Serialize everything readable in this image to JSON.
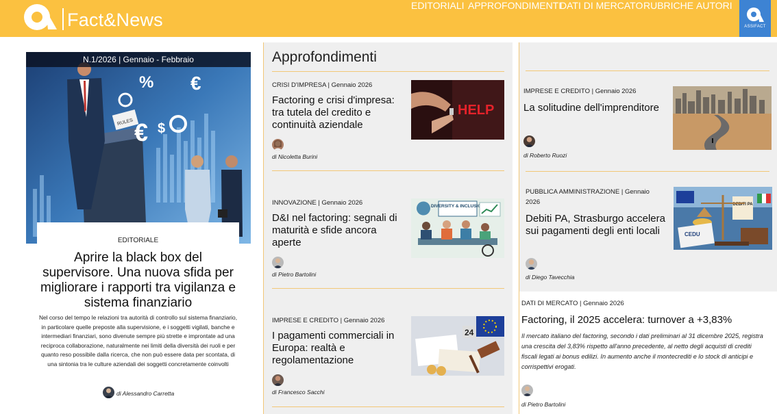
{
  "header": {
    "logo_text": "Fact&News",
    "nav": [
      "EDITORIALI",
      "APPROFONDIMENTI",
      "DATI DI MERCATO",
      "RUBRICHE",
      "AUTORI"
    ],
    "assifact_label": "ASSIFACT"
  },
  "editorial": {
    "issue": "N.1/2026 | Gennaio - Febbraio",
    "category": "EDITORIALE",
    "title": "Aprire la black box del supervisore. Una nuova sfida per migliorare i rapporti tra vigilanza e sistema finanziario",
    "excerpt": "Nel corso del tempo le relazioni tra autorità di controllo sul sistema finanziario, in particolare quelle preposte alla supervisione, e i soggetti vigilati, banche e intermediari finanziari, sono divenute sempre più strette e improntate ad una reciproca collaborazione, naturalmente nei limiti della diversità dei ruoli e per quanto reso possibile dalla ricerca, che non può essere data per scontata, di una sintonia tra le culture aziendali dei soggetti concretamente coinvolti",
    "author": "di Alessandro Carretta",
    "image_words": {
      "rules": "RULES"
    }
  },
  "approfondimenti": {
    "section_title": "Approfondimenti",
    "articles": [
      {
        "category": "CRISI D'IMPRESA | Gennaio 2026",
        "title": "Factoring e crisi d'impresa: tra tutela del credito e continuità aziendale",
        "author": "di Nicoletta Burini",
        "image_text": "HELP"
      },
      {
        "category": "INNOVAZIONE | Gennaio 2026",
        "title": "D&I nel factoring: segnali di maturità e sfide ancora aperte",
        "author": "di Pietro Bartolini",
        "image_text": "DIVERSITY & INCLUSION"
      },
      {
        "category": "IMPRESE E CREDITO | Gennaio 2026",
        "title": "I pagamenti commerciali in Europa: realtà e regolamentazione",
        "author": "di Francesco Sacchi",
        "image_text": "24"
      }
    ]
  },
  "right": {
    "articles": [
      {
        "category": "IMPRESE E CREDITO | Gennaio 2026",
        "title": "La solitudine dell'imprenditore",
        "author": "di Roberto Ruozi"
      },
      {
        "category_line1": "PUBBLICA AMMINISTRAZIONE | Gennaio",
        "category_line2": "2026",
        "title": "Debiti PA, Strasburgo accelera sui pagamenti degli enti locali",
        "author": "di Diego Tavecchia",
        "image_text_1": "DEBITI PA",
        "image_text_2": "CEDU"
      }
    ],
    "news": {
      "category": "DATI DI MERCATO | Gennaio 2026",
      "title": "Factoring, il 2025 accelera: turnover a +3,83%",
      "excerpt": "Il mercato italiano del factoring, secondo i dati preliminari al 31 dicembre 2025, registra una crescita del 3,83% rispetto all'anno precedente, al netto degli acquisti di crediti fiscali legati ai bonus edilizi. In aumento anche il montecrediti e lo stock di anticipi e corrispettivi erogati.",
      "author": "di Pietro Bartolini"
    }
  },
  "colors": {
    "header_bg": "#fbc140",
    "accent_line": "#f2c776",
    "panel_bg": "#efefef",
    "assifact_bg": "#3d83d3"
  }
}
